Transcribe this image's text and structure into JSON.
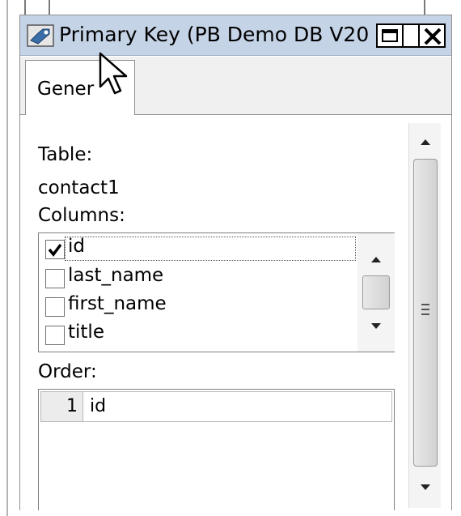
{
  "window": {
    "title": "Primary Key (PB Demo DB V20",
    "title_icon": "primary-key-icon",
    "buttons": [
      "maximize-icon",
      "close-icon"
    ]
  },
  "tabs": [
    {
      "label": "Gener"
    }
  ],
  "general": {
    "table_label": "Table:",
    "table_value": "contact1",
    "columns_label": "Columns:",
    "columns": [
      {
        "name": "id",
        "checked": true
      },
      {
        "name": "last_name",
        "checked": false
      },
      {
        "name": "first_name",
        "checked": false
      },
      {
        "name": "title",
        "checked": false
      }
    ],
    "order_label": "Order:",
    "order": [
      {
        "index": "1",
        "column": "id"
      }
    ]
  },
  "colors": {
    "titlebar": "#c5d3e6",
    "window_border": "#8f8f8f"
  },
  "cursor": "arrow-cursor-icon"
}
